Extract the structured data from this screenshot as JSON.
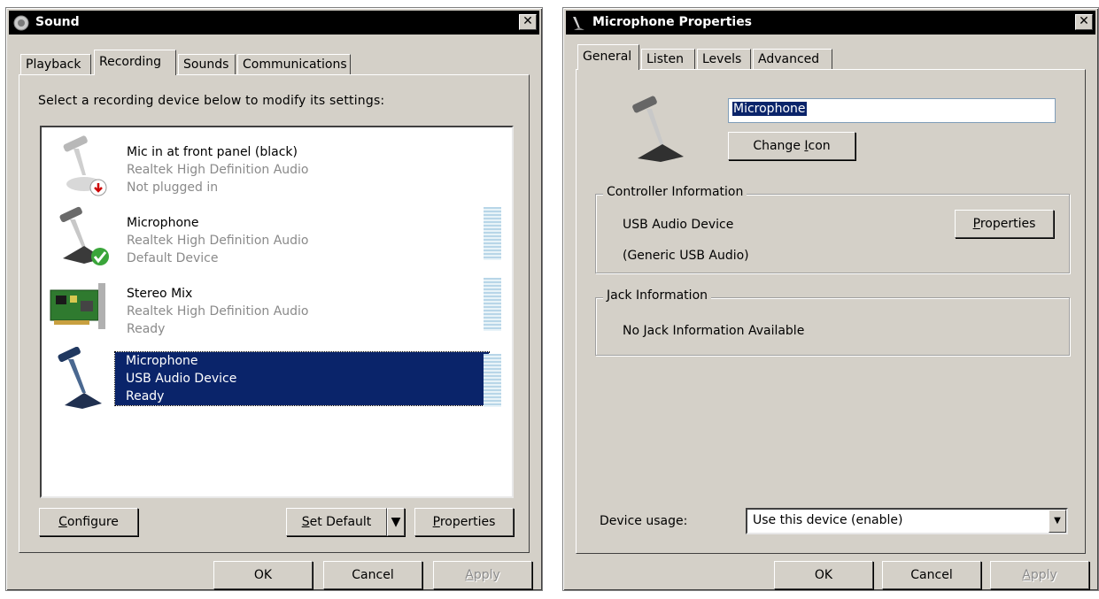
{
  "sound": {
    "title": "Sound",
    "close": "✕",
    "tabs": [
      "Playback",
      "Recording",
      "Sounds",
      "Communications"
    ],
    "active_tab": "Recording",
    "instruction": "Select a recording device below to modify its settings:",
    "devices": [
      {
        "name": "Mic in at front panel (black)",
        "driver": "Realtek High Definition Audio",
        "status": "Not plugged in",
        "icon": "microphone-unplugged-icon"
      },
      {
        "name": "Microphone",
        "driver": "Realtek High Definition Audio",
        "status": "Default Device",
        "icon": "microphone-default-icon"
      },
      {
        "name": "Stereo Mix",
        "driver": "Realtek High Definition Audio",
        "status": "Ready",
        "icon": "sound-card-icon"
      },
      {
        "name": "Microphone",
        "driver": "USB Audio Device",
        "status": "Ready",
        "icon": "usb-microphone-icon"
      }
    ],
    "buttons": {
      "configure_pre": "",
      "configure_key": "C",
      "configure_post": "onfigure",
      "setdefault_pre": "",
      "setdefault_key": "S",
      "setdefault_post": "et Default",
      "properties_pre": "",
      "properties_key": "P",
      "properties_post": "roperties",
      "ok": "OK",
      "cancel": "Cancel",
      "apply_pre": "",
      "apply_key": "A",
      "apply_post": "pply"
    }
  },
  "mic": {
    "title": "Microphone Properties",
    "close": "✕",
    "tabs": [
      "General",
      "Listen",
      "Levels",
      "Advanced"
    ],
    "active_tab": "General",
    "name_value": "Microphone",
    "change_icon_pre": "Change ",
    "change_icon_key": "I",
    "change_icon_post": "con",
    "controller": {
      "title": "Controller Information",
      "device": "USB Audio Device",
      "driver": "(Generic USB Audio)",
      "properties_pre": "",
      "properties_key": "P",
      "properties_post": "roperties"
    },
    "jack": {
      "title": "Jack Information",
      "text": "No Jack Information Available"
    },
    "usage": {
      "label": "Device usage:",
      "value": "Use this device (enable)"
    },
    "buttons": {
      "ok": "OK",
      "cancel": "Cancel",
      "apply_pre": "",
      "apply_key": "A",
      "apply_post": "pply"
    }
  }
}
